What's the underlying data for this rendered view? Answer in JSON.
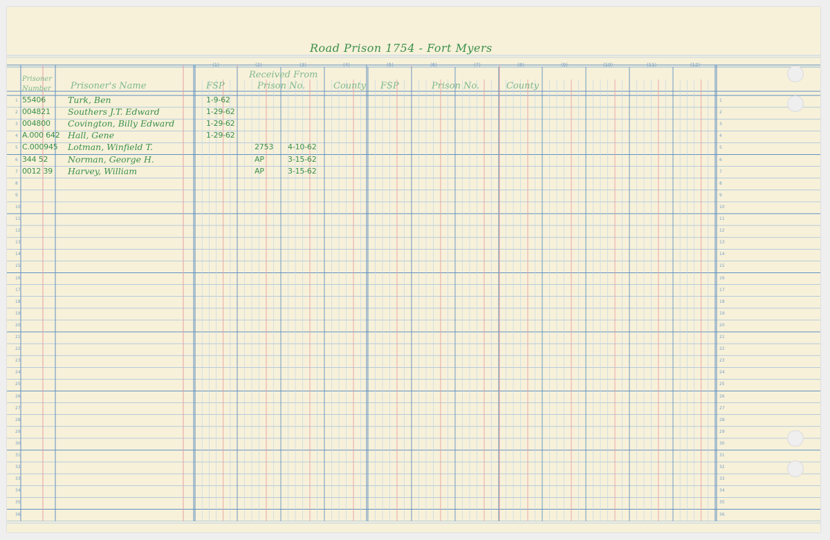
{
  "title": "Road Prison 1754 - Fort Myers",
  "header": {
    "prisoner_number": "Prisoner Number",
    "prisoners_name": "Prisoner's Name",
    "received_from": "Received From",
    "fsp": "FSP",
    "prison_no": "Prison No.",
    "county": "County",
    "fsp2": "FSP",
    "prison_no2": "Prison No.",
    "county2": "County"
  },
  "column_numbers": [
    "(1)",
    "(2)",
    "(3)",
    "(4)",
    "(5)",
    "(6)",
    "(7)",
    "(8)",
    "(9)",
    "(10)",
    "(11)",
    "(12)"
  ],
  "line_numbers": [
    "1",
    "2",
    "3",
    "4",
    "5",
    "6",
    "7",
    "8",
    "9",
    "10",
    "11",
    "12",
    "13",
    "14",
    "15",
    "16",
    "17",
    "18",
    "19",
    "20",
    "21",
    "22",
    "23",
    "24",
    "25",
    "26",
    "27",
    "28",
    "29",
    "30",
    "31",
    "32",
    "33",
    "34",
    "35",
    "36"
  ],
  "rows": [
    {
      "number": "55406",
      "name": "Turk, Ben",
      "fsp": "1-9-62",
      "prison_no": "",
      "date": ""
    },
    {
      "number": "004821",
      "name": "Southers J.T. Edward",
      "fsp": "1-29-62",
      "prison_no": "",
      "date": ""
    },
    {
      "number": "004800",
      "name": "Covington, Billy Edward",
      "fsp": "1-29-62",
      "prison_no": "",
      "date": ""
    },
    {
      "number": "A.000 642",
      "name": "Hall, Gene",
      "fsp": "1-29-62",
      "prison_no": "",
      "date": ""
    },
    {
      "number": "C.000945",
      "name": "Lotman, Winfield T.",
      "fsp": "",
      "prison_no": "2753",
      "date": "4-10-62"
    },
    {
      "number": "344 52",
      "name": "Norman, George H.",
      "fsp": "",
      "prison_no": "AP",
      "date": "3-15-62"
    },
    {
      "number": "0012 39",
      "name": "Harvey, William",
      "fsp": "",
      "prison_no": "AP",
      "date": "3-15-62"
    }
  ]
}
